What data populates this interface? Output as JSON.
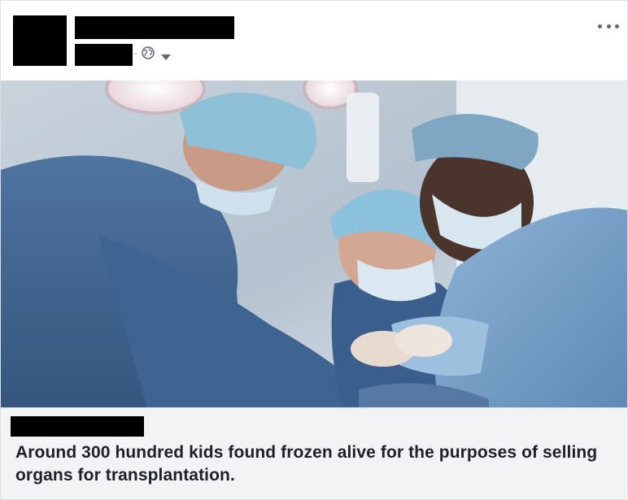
{
  "post": {
    "privacy_icon": "globe-icon",
    "privacy_menu_icon": "caret-down-icon",
    "more_options_icon": "ellipsis-icon",
    "meta_separator": "·"
  },
  "link_preview": {
    "headline": "Around 300 hundred kids found frozen alive for the purposes of selling organs for transplantation."
  },
  "colors": {
    "card_border": "#dddfe2",
    "preview_background": "#f2f3f5",
    "headline_text": "#1d2129",
    "meta_icon": "#606770",
    "redaction": "#000000"
  }
}
